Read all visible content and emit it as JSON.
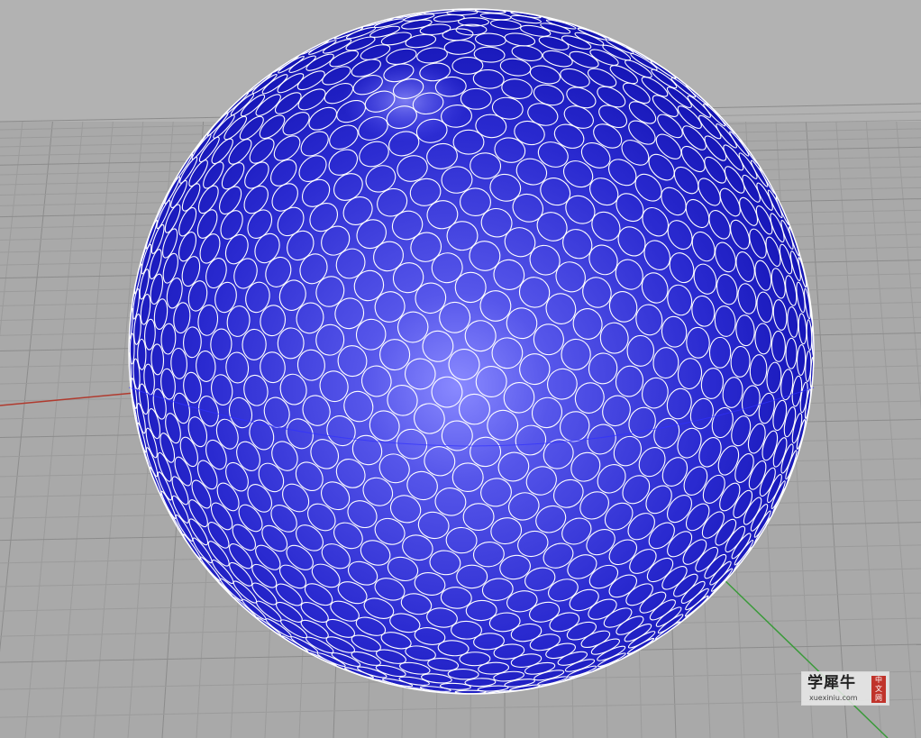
{
  "viewport": {
    "background_color": "#a9a9a9",
    "grid_line_color": "#9b9b9b",
    "grid_major_color": "#8c8c8c",
    "x_axis_color": "#b03a2e",
    "y_axis_color": "#3a9a3a",
    "object": {
      "type": "sphere",
      "surface_color": "#1f1fd0",
      "highlight_color": "#8080ff",
      "circle_outline_color": "#ffffff"
    }
  },
  "watermark": {
    "title": "学犀牛",
    "url": "xuexiniu.com",
    "badge_chars": [
      "中",
      "文",
      "网"
    ],
    "badge_color": "#c0332b"
  }
}
